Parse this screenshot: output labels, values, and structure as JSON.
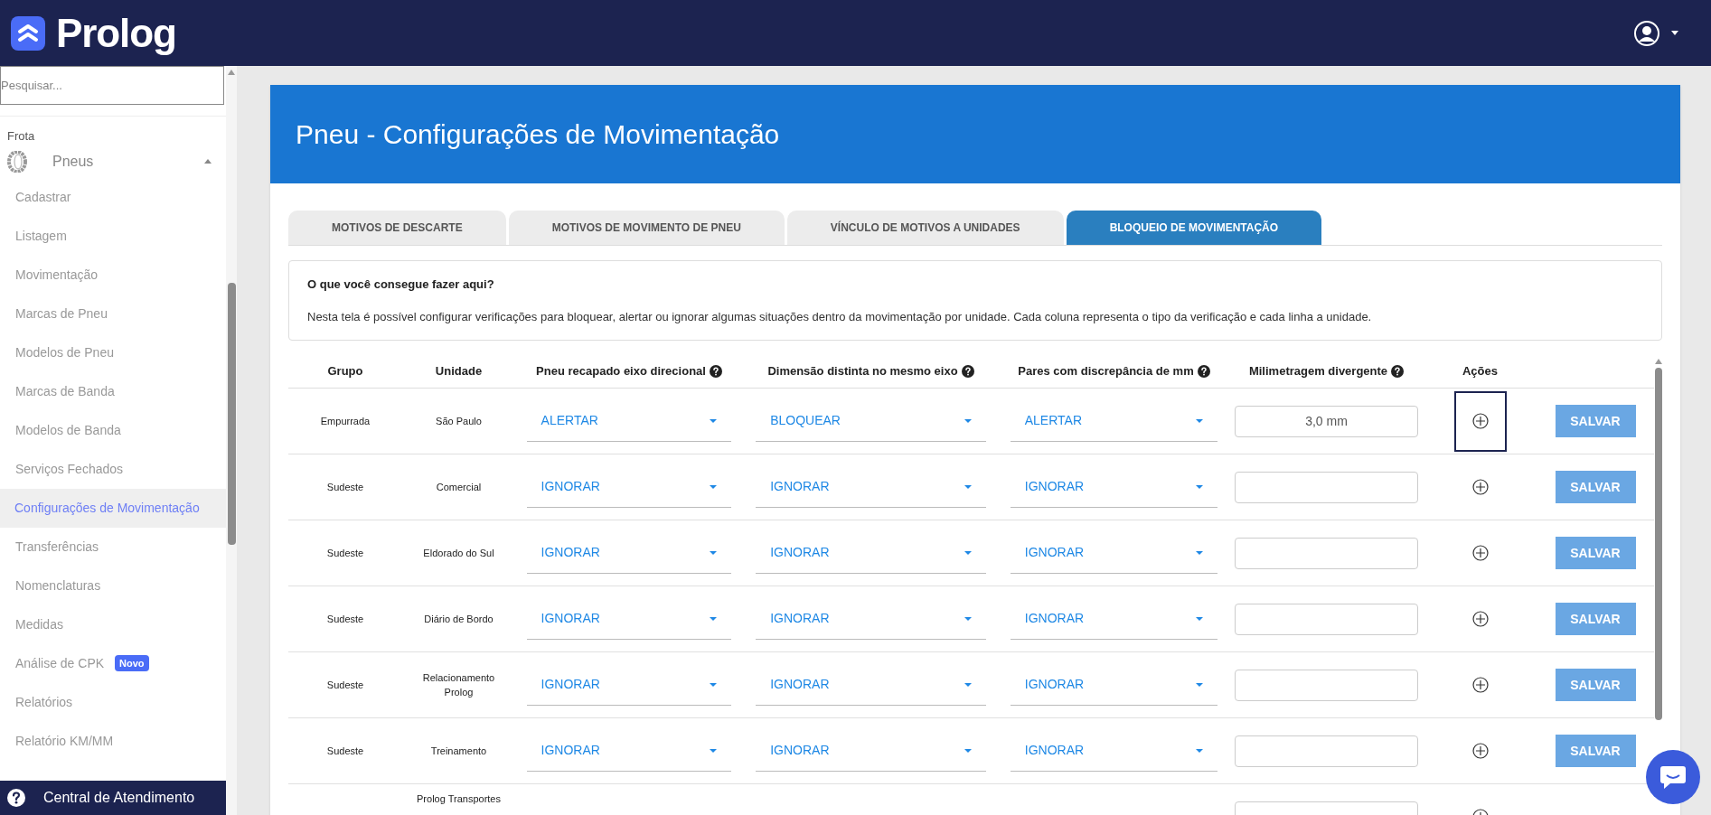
{
  "header": {
    "logo_text": "Prolog"
  },
  "sidebar": {
    "search": {
      "placeholder": "Pesquisar..."
    },
    "section": "Frota",
    "group": {
      "label": "Pneus",
      "expanded": true
    },
    "items": [
      {
        "label": "Cadastrar",
        "selected": false
      },
      {
        "label": "Listagem",
        "selected": false
      },
      {
        "label": "Movimentação",
        "selected": false
      },
      {
        "label": "Marcas de Pneu",
        "selected": false
      },
      {
        "label": "Modelos de Pneu",
        "selected": false
      },
      {
        "label": "Marcas de Banda",
        "selected": false
      },
      {
        "label": "Modelos de Banda",
        "selected": false
      },
      {
        "label": "Serviços Fechados",
        "selected": false
      },
      {
        "label": "Configurações de Movimentação",
        "selected": true
      },
      {
        "label": "Transferências",
        "selected": false
      },
      {
        "label": "Nomenclaturas",
        "selected": false
      },
      {
        "label": "Medidas",
        "selected": false
      },
      {
        "label": "Análise de CPK",
        "selected": false,
        "badge": "Novo"
      },
      {
        "label": "Relatórios",
        "selected": false
      },
      {
        "label": "Relatório KM/MM",
        "selected": false
      }
    ],
    "help": "Central de Atendimento"
  },
  "page": {
    "title": "Pneu - Configurações de Movimentação",
    "tabs": [
      {
        "label": "MOTIVOS DE DESCARTE",
        "selected": false
      },
      {
        "label": "MOTIVOS DE MOVIMENTO DE PNEU",
        "selected": false
      },
      {
        "label": "VÍNCULO DE MOTIVOS A UNIDADES",
        "selected": false
      },
      {
        "label": "BLOQUEIO DE MOVIMENTAÇÃO",
        "selected": true
      }
    ],
    "info": {
      "title": "O que você consegue fazer aqui?",
      "text": "Nesta tela é possível configurar verificações para bloquear, alertar ou ignorar algumas situações dentro da movimentação por unidade. Cada coluna representa o tipo da verificação e cada linha a unidade."
    },
    "table": {
      "columns": [
        {
          "label": "Grupo"
        },
        {
          "label": "Unidade"
        },
        {
          "label": "Pneu recapado eixo direcional",
          "help": true
        },
        {
          "label": "Dimensão distinta no mesmo eixo",
          "help": true
        },
        {
          "label": "Pares com discrepância de mm",
          "help": true
        },
        {
          "label": "Milimetragem divergente",
          "help": true
        },
        {
          "label": "Ações"
        }
      ],
      "rows": [
        {
          "group": "Empurrada",
          "unit": "São Paulo",
          "checks": [
            "ALERTAR",
            "BLOQUEAR",
            "ALERTAR"
          ],
          "mm": "3,0 mm",
          "focused": true,
          "save": "SALVAR"
        },
        {
          "group": "Sudeste",
          "unit": "Comercial",
          "checks": [
            "IGNORAR",
            "IGNORAR",
            "IGNORAR"
          ],
          "focused": false,
          "save": "SALVAR"
        },
        {
          "group": "Sudeste",
          "unit": "Eldorado do Sul",
          "checks": [
            "IGNORAR",
            "IGNORAR",
            "IGNORAR"
          ],
          "focused": false,
          "save": "SALVAR"
        },
        {
          "group": "Sudeste",
          "unit": "Diário de Bordo",
          "checks": [
            "IGNORAR",
            "IGNORAR",
            "IGNORAR"
          ],
          "focused": false,
          "save": "SALVAR"
        },
        {
          "group": "Sudeste",
          "unit": "Relacionamento Prolog",
          "checks": [
            "IGNORAR",
            "IGNORAR",
            "IGNORAR"
          ],
          "focused": false,
          "save": "SALVAR"
        },
        {
          "group": "Sudeste",
          "unit": "Treinamento",
          "checks": [
            "IGNORAR",
            "IGNORAR",
            "IGNORAR"
          ],
          "focused": false,
          "save": "SALVAR"
        },
        {
          "unit": "Prolog Transportes",
          "checks": [],
          "focused": false
        }
      ]
    }
  }
}
